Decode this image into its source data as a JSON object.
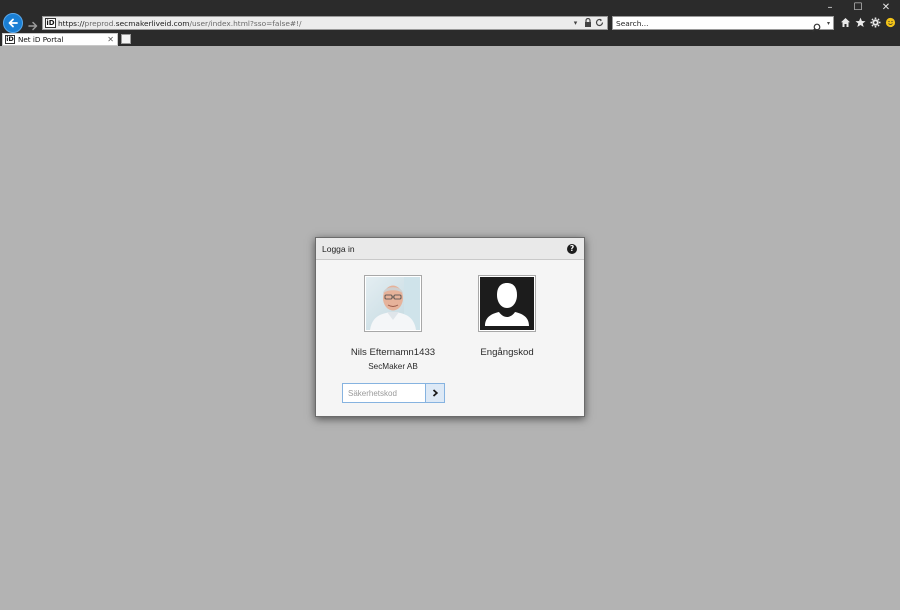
{
  "window": {
    "minimize": "–",
    "maximize": "☐",
    "close": "✕"
  },
  "browser": {
    "url_protocol": "https://",
    "url_subdomain": "preprod.",
    "url_domain": "secmakerliveid.com",
    "url_path": "/user/index.html?sso=false#!/",
    "search_placeholder": "Search...",
    "tab_title": "Net iD Portal",
    "favicon_text": "iD"
  },
  "dialog": {
    "title": "Logga in",
    "help": "?",
    "accounts": [
      {
        "name": "Nils Efternamn1433",
        "org": "SecMaker AB"
      },
      {
        "name": "Engångskod"
      }
    ],
    "code_placeholder": "Säkerhetskod"
  },
  "colors": {
    "accent": "#1a7fd4",
    "content_bg": "#b3b3b3",
    "chrome_bg": "#2b2b2b"
  }
}
